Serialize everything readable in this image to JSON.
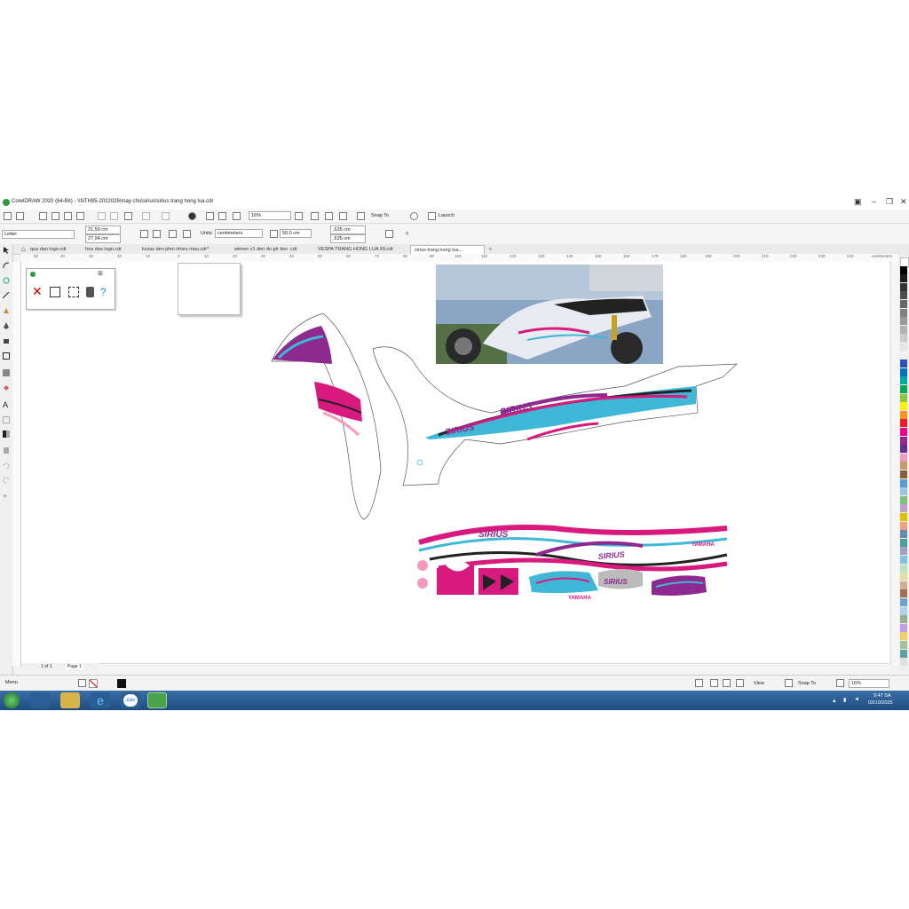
{
  "window": {
    "title": "CorelDRAW 2020 (64-Bit) - \\\\NTH95-2022026\\may chu\\sirius\\sirius trang hong lua.cdr"
  },
  "toolbar": {
    "zoom_value": "16%",
    "snap_label": "Snap To",
    "launch_label": "Launch"
  },
  "property_bar": {
    "page_size": "Letter",
    "width": "21,59 cm",
    "height": "27,94 cm",
    "units_label": "Units:",
    "units_value": "centimeters",
    "nudge": "50,0 cm",
    "dup_x": ",635 cm",
    "dup_y": ",635 cm"
  },
  "tabs": [
    {
      "label": "qua dao logo.cdr"
    },
    {
      "label": "hoa dao logo.cdr"
    },
    {
      "label": "luvias den phoi nhieu mau.cdr*"
    },
    {
      "label": "winner v1 den do gtr tien .cdr"
    },
    {
      "label": "VESPA TRANG HONG LUA 99.cdr"
    },
    {
      "label": "sirius trang hong lua...",
      "active": true
    }
  ],
  "ruler": {
    "unit": "centimeters",
    "ticks": [
      "50",
      "40",
      "30",
      "20",
      "10",
      "0",
      "10",
      "20",
      "30",
      "40",
      "50",
      "60",
      "70",
      "80",
      "90",
      "100",
      "110",
      "120",
      "130",
      "140",
      "150",
      "160",
      "170",
      "180",
      "190",
      "200",
      "210",
      "220",
      "230",
      "240",
      "250",
      "260"
    ]
  },
  "page_nav": {
    "counter": "1 of 1",
    "page_label": "Page 1"
  },
  "statusbar": {
    "menu_label": "Menu",
    "view_label": "View",
    "snap_label": "Snap To",
    "zoom_value": "16%"
  },
  "taskbar": {
    "time": "9:47 SA",
    "date": "03/10/2025",
    "zalo_label": "Zalo"
  },
  "artwork": {
    "brand_text": "YAMAHA",
    "model_text": "SIRIUS"
  },
  "colors": {
    "accent_pink": "#d8197e",
    "accent_cyan": "#3fb8d8",
    "palette": [
      "#ffffff",
      "#000000",
      "#1a1a1a",
      "#333333",
      "#4d4d4d",
      "#666666",
      "#808080",
      "#999999",
      "#b3b3b3",
      "#cccccc",
      "#e6e6e6",
      "#f2f2f2",
      "#2a52be",
      "#0070c0",
      "#00a99d",
      "#00a651",
      "#8cc63f",
      "#fff200",
      "#f7941d",
      "#ed1c24",
      "#ec008c",
      "#92278f",
      "#662d91",
      "#f49ac1",
      "#c69c6d",
      "#8b5e3c",
      "#5a9bd5",
      "#9dc3e6",
      "#7fbf7f",
      "#bfa0d0",
      "#e0c000",
      "#f0a080",
      "#6a8caf",
      "#4aa0a0",
      "#a0a0c0",
      "#80c0e0",
      "#c0e0c0",
      "#e0e0a0",
      "#d0b090",
      "#a07050",
      "#70a0d0",
      "#b0d0f0",
      "#90b090",
      "#c0a0e0",
      "#f0d060",
      "#a0c0a0",
      "#60a0a0",
      "#e0e0e0"
    ]
  }
}
